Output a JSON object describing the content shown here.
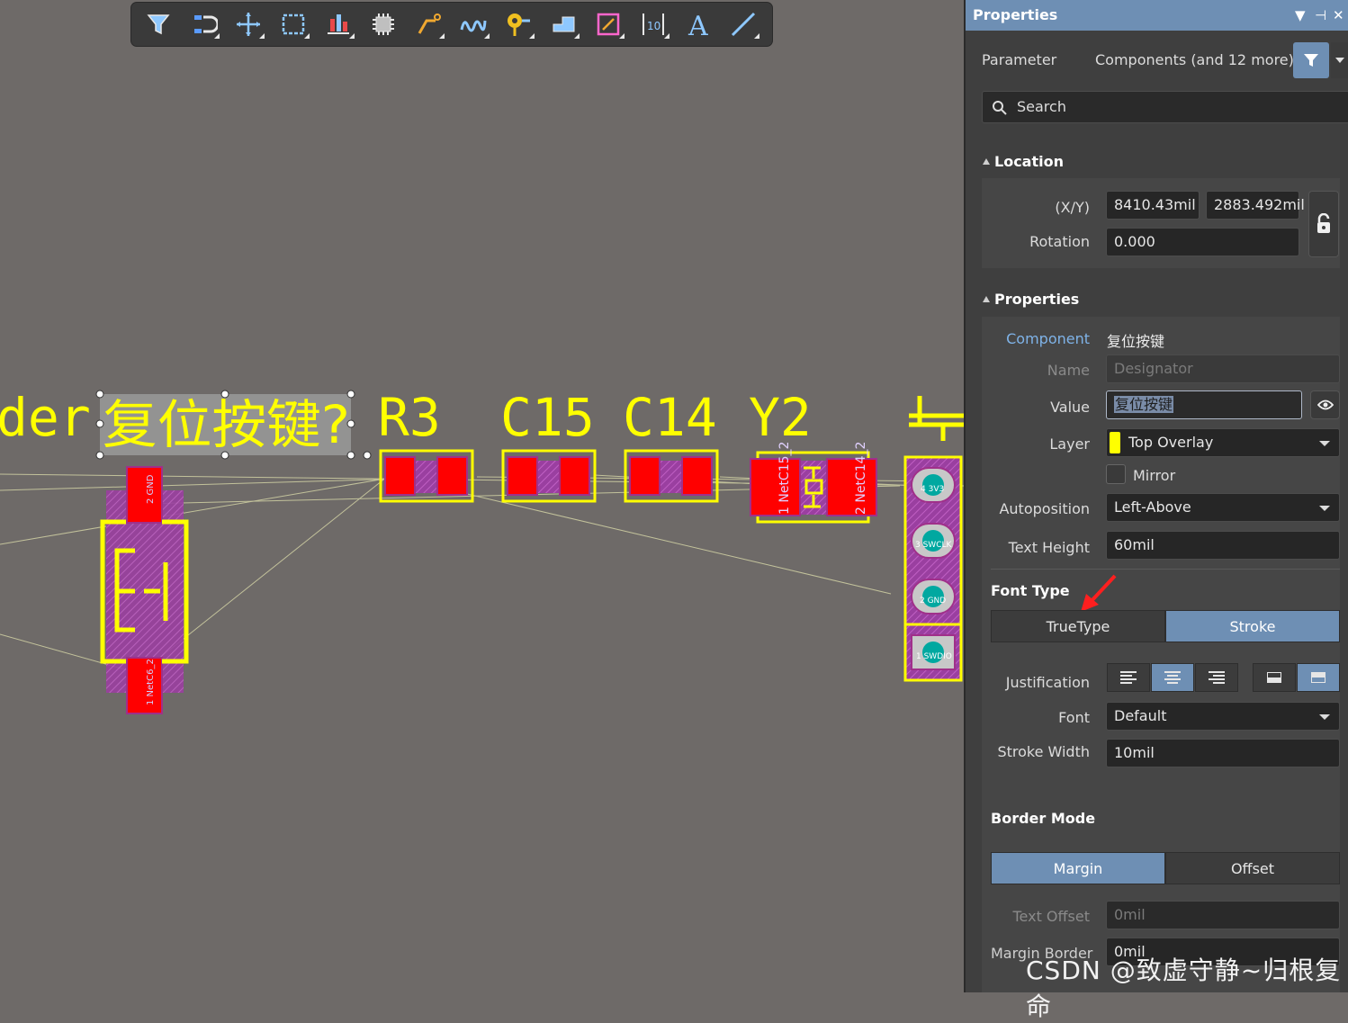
{
  "canvas": {
    "labels": {
      "partial_left": "der",
      "r3": "R3",
      "c15": "C15",
      "c14": "C14",
      "y2": "Y2",
      "selected_value": "复位按键?"
    },
    "pads": {
      "gnd_top": "2 GND",
      "netc6": "1 NetC6_2",
      "y2_left": "1 NetC15_2",
      "y2_right": "2 NetC14_2",
      "h1": "4 3V3",
      "h2": "3 SWCLK",
      "h3": "2 GND",
      "h4": "1 SWDIO"
    }
  },
  "toolbar": {
    "items": [
      {
        "name": "filter-icon"
      },
      {
        "name": "snap-magnet-icon"
      },
      {
        "name": "move-icon"
      },
      {
        "name": "select-rect-icon"
      },
      {
        "name": "align-icon"
      },
      {
        "name": "component-icon"
      },
      {
        "name": "route-icon"
      },
      {
        "name": "interactive-route-icon"
      },
      {
        "name": "via-icon"
      },
      {
        "name": "polygon-icon"
      },
      {
        "name": "keepout-icon"
      },
      {
        "name": "dimension-icon"
      },
      {
        "name": "text-icon"
      },
      {
        "name": "line-icon"
      }
    ]
  },
  "panel": {
    "title": "Properties",
    "parameter_label": "Parameter",
    "parameter_value": "Components (and 12 more)",
    "search_placeholder": "Search",
    "location": {
      "title": "Location",
      "xy_label": "(X/Y)",
      "x": "8410.43mil",
      "y": "2883.492mil",
      "rotation_label": "Rotation",
      "rotation": "0.000"
    },
    "properties": {
      "title": "Properties",
      "component_label": "Component",
      "component_value": "复位按键",
      "name_label": "Name",
      "name_value": "Designator",
      "value_label": "Value",
      "value_value": "复位按键",
      "layer_label": "Layer",
      "layer_value": "Top Overlay",
      "mirror_label": "Mirror",
      "autoposition_label": "Autoposition",
      "autoposition_value": "Left-Above",
      "text_height_label": "Text Height",
      "text_height_value": "60mil"
    },
    "font_type": {
      "title": "Font Type",
      "truetype": "TrueType",
      "stroke": "Stroke"
    },
    "justification_label": "Justification",
    "font_label": "Font",
    "font_value": "Default",
    "stroke_width_label": "Stroke Width",
    "stroke_width_value": "10mil",
    "border_mode": {
      "title": "Border Mode",
      "margin": "Margin",
      "offset": "Offset"
    },
    "text_offset_label": "Text Offset",
    "text_offset_value": "0mil",
    "margin_border_label": "Margin Border",
    "margin_border_value": "0mil"
  },
  "watermark": "CSDN @致虚守静~归根复命",
  "colors": {
    "silk": "#ffff00",
    "pad": "#ff0000",
    "accent": "#6e8fb4",
    "canvas": "#6e6a68"
  }
}
